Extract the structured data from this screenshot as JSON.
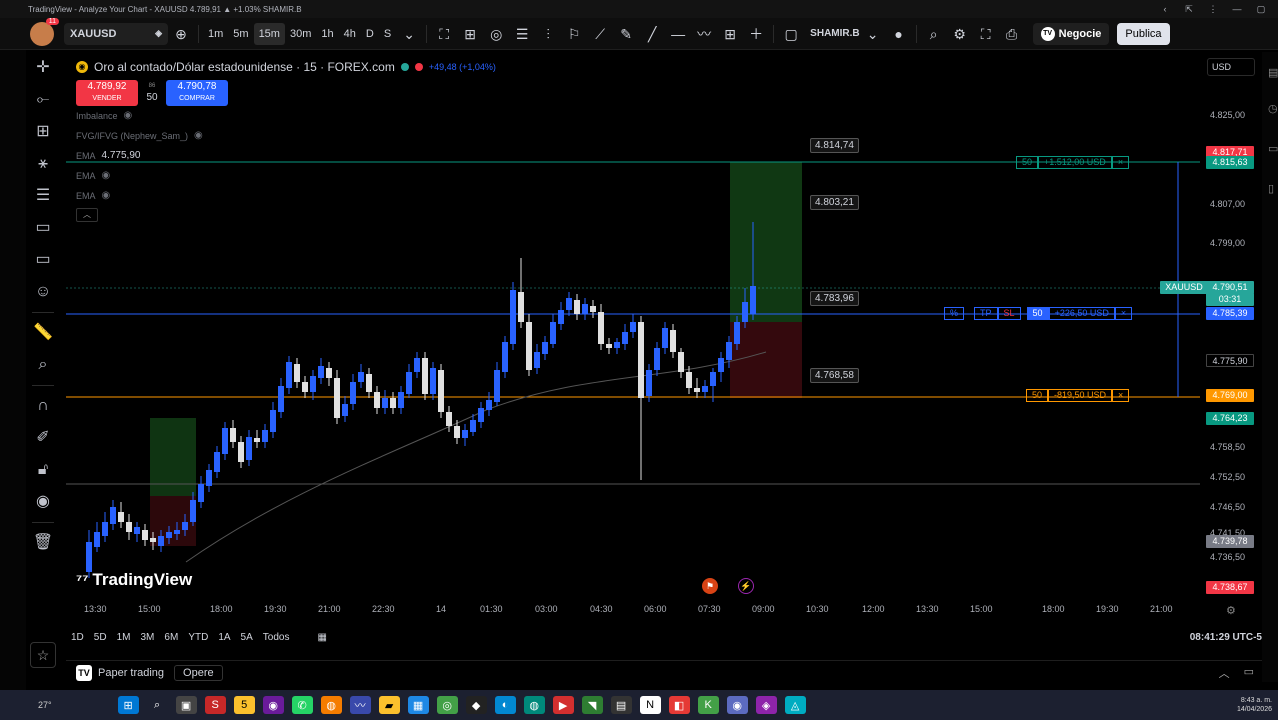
{
  "window": {
    "title": "TradingView - Analyze Your Chart - XAUUSD 4.789,91 ▲ +1.03% SHAMIR.B",
    "controls": [
      "‹",
      "⇱",
      "⋮",
      "—",
      "▢"
    ]
  },
  "toolbar": {
    "symbol": "XAUUSD",
    "intervals": [
      "1m",
      "5m",
      "15m",
      "30m",
      "1h",
      "4h",
      "D",
      "S"
    ],
    "active_interval": "15m",
    "user": "SHAMIR.B",
    "trade_button": "Negocie",
    "publish_button": "Publica"
  },
  "legend": {
    "title": "Oro al contado/Dólar estadounidense · 15 · FOREX.com",
    "change": "+49,48 (+1,04%)",
    "sell_price": "4.789,92",
    "sell_label": "VENDER",
    "spread": "86",
    "qty": "50",
    "buy_price": "4.790,78",
    "buy_label": "COMPRAR",
    "indicators": [
      {
        "name": "Imbalance",
        "value": ""
      },
      {
        "name": "FVG/IFVG (Nephew_Sam_)",
        "value": ""
      },
      {
        "name": "EMA",
        "value": "4.775,90"
      },
      {
        "name": "EMA",
        "value": ""
      },
      {
        "name": "EMA",
        "value": ""
      }
    ]
  },
  "price_axis": {
    "currency": "USD",
    "ticks": [
      "4.825,00",
      "4.807,00",
      "4.799,00",
      "4.775,90",
      "4.758,50",
      "4.752,50",
      "4.746,50",
      "4.741,50",
      "4.736,50"
    ],
    "tags": [
      {
        "label": "4.817,71",
        "color": "#f23645"
      },
      {
        "label": "4.815,63",
        "color": "#089981"
      },
      {
        "label": "XAUUSD",
        "color": "#26a69a"
      },
      {
        "label": "4.790,51",
        "color": "#26a69a"
      },
      {
        "label": "03:31",
        "color": "#26a69a"
      },
      {
        "label": "4.785,39",
        "color": "#2962ff"
      },
      {
        "label": "4.769,00",
        "color": "#ff9800"
      },
      {
        "label": "4.764,23",
        "color": "#089981"
      },
      {
        "label": "4.739,78",
        "color": "#787b86"
      },
      {
        "label": "4.738,67",
        "color": "#f23645"
      }
    ]
  },
  "chart_labels": {
    "tp_top": "4.814,74",
    "mid1": "4.803,21",
    "mid2": "4.783,96",
    "sl": "4.768,58"
  },
  "positions": {
    "tp": {
      "qty": "50",
      "pnl": "+1.512,00 USD"
    },
    "entry": {
      "tp": "TP",
      "sl": "SL",
      "qty": "50",
      "pnl": "+226,50 USD"
    },
    "sl": {
      "qty": "50",
      "pnl": "-819,50 USD"
    },
    "close": "×",
    "pct": "%"
  },
  "time_axis": [
    "13:30",
    "15:00",
    "18:00",
    "19:30",
    "21:00",
    "22:30",
    "14",
    "01:30",
    "03:00",
    "04:30",
    "06:00",
    "07:30",
    "09:00",
    "10:30",
    "12:00",
    "13:30",
    "15:00",
    "18:00",
    "19:30",
    "21:00"
  ],
  "range_bar": {
    "ranges": [
      "1D",
      "5D",
      "1M",
      "3M",
      "6M",
      "YTD",
      "1A",
      "5A",
      "Todos"
    ],
    "clock": "08:41:29 UTC-5"
  },
  "bottom": {
    "paper_trading": "Paper trading",
    "opere": "Opere"
  },
  "watermark": "TradingView",
  "taskbar": {
    "weather": "27°",
    "time": "8:43 a. m.",
    "date": "14/04/2026"
  },
  "colors": {
    "bull": "#2962ff",
    "bear": "#e0e0e0",
    "tp_zone": "#1b5e20",
    "sl_zone": "#4a0d12",
    "entry_line": "#2962ff",
    "sl_line": "#ff9800",
    "tp_line": "#089981"
  }
}
